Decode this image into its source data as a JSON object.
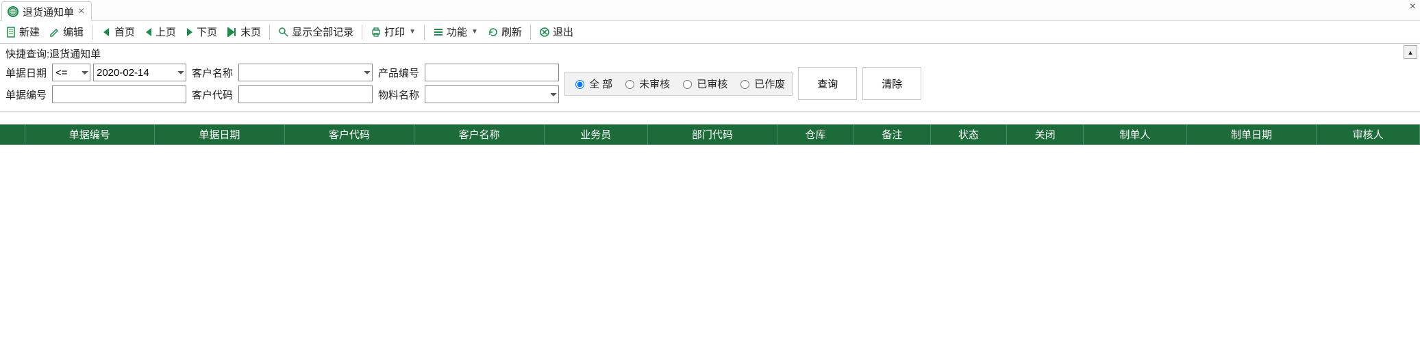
{
  "tab": {
    "title": "退货通知单"
  },
  "toolbar": {
    "new": "新建",
    "edit": "编辑",
    "first": "首页",
    "prev": "上页",
    "next": "下页",
    "last": "末页",
    "showAll": "显示全部记录",
    "print": "打印",
    "functions": "功能",
    "refresh": "刷新",
    "exit": "退出"
  },
  "query": {
    "title": "快捷查询:退货通知单",
    "labels": {
      "billDate": "单据日期",
      "billNo": "单据编号",
      "custName": "客户名称",
      "custCode": "客户代码",
      "prodCode": "产品编号",
      "matName": "物料名称"
    },
    "op": "<=",
    "date": "2020-02-14",
    "billNo": "",
    "custName": "",
    "custCode": "",
    "prodCode": "",
    "matName": "",
    "status": {
      "all": "全  部",
      "unapproved": "未审核",
      "approved": "已审核",
      "voided": "已作废",
      "selected": "all"
    },
    "buttons": {
      "search": "查询",
      "clear": "清除"
    }
  },
  "columns": [
    "单据编号",
    "单据日期",
    "客户代码",
    "客户名称",
    "业务员",
    "部门代码",
    "仓库",
    "备注",
    "状态",
    "关闭",
    "制单人",
    "制单日期",
    "审核人"
  ]
}
